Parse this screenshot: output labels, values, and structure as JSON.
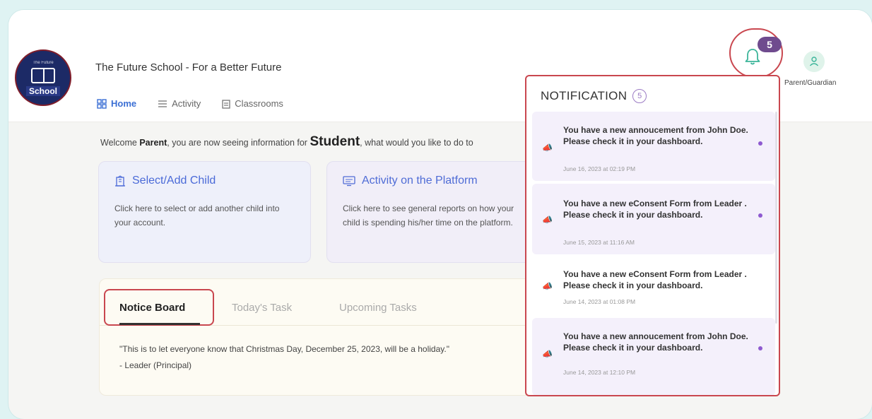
{
  "app": {
    "logo_text": "School",
    "logo_top_text": "The Future",
    "title": "The Future School - For a Better Future",
    "user_role": "Parent/Guardian",
    "notification_badge": "5"
  },
  "nav": {
    "items": [
      {
        "label": "Home",
        "icon": "grid-icon"
      },
      {
        "label": "Activity",
        "icon": "list-icon"
      },
      {
        "label": "Classrooms",
        "icon": "clipboard-icon"
      }
    ]
  },
  "welcome": {
    "prefix": "Welcome ",
    "name": "Parent",
    "middle": ", you are now seeing information for ",
    "student": "Student",
    "suffix": ", what would you like to do to"
  },
  "cards": [
    {
      "title": "Select/Add Child",
      "icon": "building-icon",
      "desc": "Click here to select or add another child into your account."
    },
    {
      "title": "Activity on the Platform",
      "icon": "monitor-icon",
      "desc": "Click here to see general reports on how your child is spending his/her time on the platform."
    }
  ],
  "board": {
    "tabs": [
      "Notice Board",
      "Today's Task",
      "Upcoming Tasks"
    ],
    "text": "\"This is to let everyone know that Christmas Day, December 25, 2023, will be a holiday.\"",
    "author": "- Leader (Principal)"
  },
  "notifications": {
    "title": "NOTIFICATION",
    "count": "5",
    "items": [
      {
        "message": "You have a new annoucement from John Doe. Please check it in your dashboard.",
        "time": "June 16, 2023 at 02:19 PM",
        "unread": true
      },
      {
        "message": "You have a new eConsent Form from Leader . Please check it in your dashboard.",
        "time": "June 15, 2023 at 11:16 AM",
        "unread": true
      },
      {
        "message": "You have a new eConsent Form from Leader . Please check it in your dashboard.",
        "time": "June 14, 2023 at 01:08 PM",
        "unread": false
      },
      {
        "message": "You have a new annoucement from John Doe. Please check it in your dashboard.",
        "time": "June 14, 2023 at 12:10 PM",
        "unread": true
      }
    ]
  },
  "colors": {
    "accent": "#3b6fd4",
    "highlight_border": "#c9474f",
    "badge": "#6f4b8e",
    "unread_dot": "#8e5ad0"
  }
}
